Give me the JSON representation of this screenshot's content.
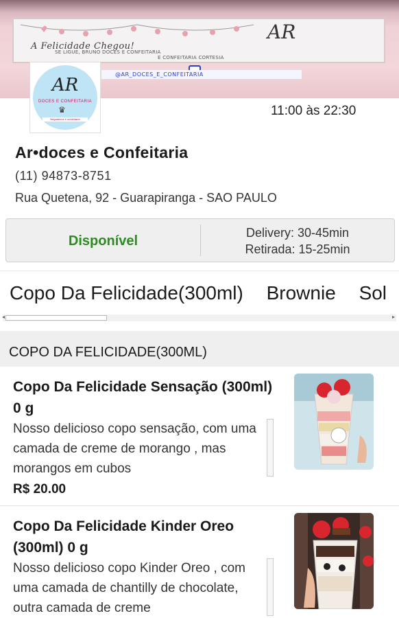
{
  "banner": {
    "script_text": "A Felicidade Chegou!",
    "line1": "SE LIGUE, BRUNO    DOCES E CONFEITARIA",
    "line2": "E CONFEITARIA CORTESIA",
    "logo_text": "AR",
    "handle": "@AR_DOCES_E_CONFEITARIA"
  },
  "store": {
    "logo_text": "AR",
    "logo_sub": "DOCES E CONFEITARIA",
    "logo_tag": "Brigadeiros e confeitaria",
    "hours": "11:00 às 22:30",
    "name": "Ar•doces e Confeitaria",
    "phone": "(11) 94873-8751",
    "address": "Rua Quetena, 92 - Guarapiranga - SAO PAULO"
  },
  "status": {
    "available_label": "Disponível",
    "delivery": "Delivery: 30-45min",
    "pickup": "Retirada: 15-25min"
  },
  "tabs": [
    {
      "label": "Copo Da Felicidade(300ml)"
    },
    {
      "label": "Brownie"
    },
    {
      "label": "Sol"
    }
  ],
  "section": {
    "title": "COPO DA FELICIDADE(300ML)"
  },
  "products": [
    {
      "title": "Copo Da Felicidade Sensação (300ml) 0 g",
      "description": "Nosso delicioso copo sensação, com uma camada de creme de morango , mas morangos em cubos",
      "price": "R$ 20.00"
    },
    {
      "title": "Copo Da Felicidade Kinder Oreo (300ml) 0 g",
      "description": "Nosso delicioso copo Kinder Oreo , com uma camada de chantilly de chocolate, outra camada de creme",
      "price": ""
    }
  ],
  "colors": {
    "available": "#2e8b22",
    "banner_pink": "#efd2d6",
    "logo_blue": "#bfe4f5"
  }
}
